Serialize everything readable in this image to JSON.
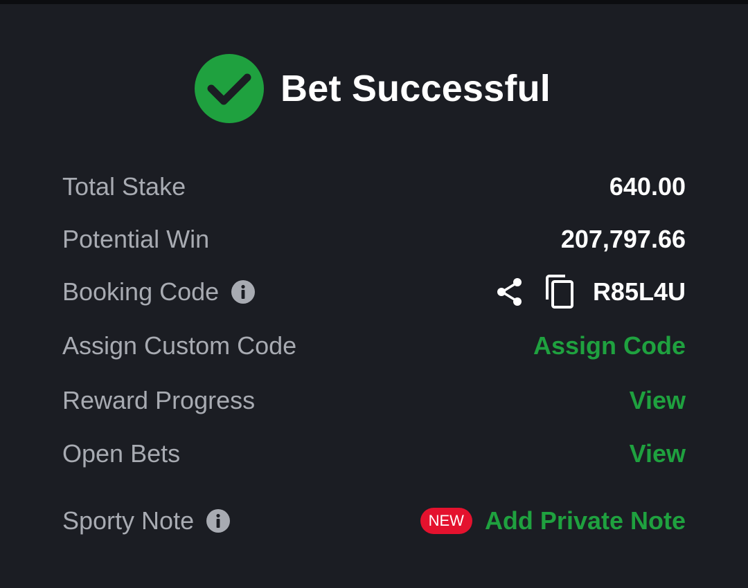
{
  "header": {
    "title": "Bet Successful",
    "icon": "check-circle-icon",
    "accent_color": "#1fa13f"
  },
  "details": {
    "total_stake": {
      "label": "Total Stake",
      "value": "640.00"
    },
    "potential_win": {
      "label": "Potential Win",
      "value": "207,797.66"
    },
    "booking_code": {
      "label": "Booking Code",
      "value": "R85L4U",
      "icons": [
        "info-icon",
        "share-icon",
        "copy-icon"
      ]
    },
    "custom_code": {
      "label": "Assign Custom Code",
      "action": "Assign Code"
    },
    "reward_progress": {
      "label": "Reward Progress",
      "action": "View"
    },
    "open_bets": {
      "label": "Open Bets",
      "action": "View"
    },
    "sporty_note": {
      "label": "Sporty Note",
      "badge": "NEW",
      "action": "Add Private Note",
      "badge_color": "#e4122e"
    }
  }
}
